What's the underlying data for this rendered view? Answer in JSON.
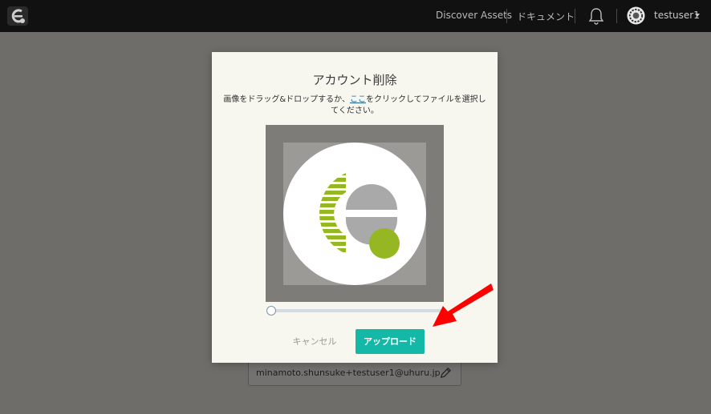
{
  "header": {
    "nav_items": [
      "Discover Assets",
      "ドキュメント"
    ],
    "username": "testuser1",
    "icons": [
      "app-logo-icon",
      "bell-icon",
      "avatar-icon",
      "caret-down-icon"
    ]
  },
  "profile": {
    "email": "minamoto.shunsuke+testuser1@uhuru.jp",
    "edit_icon": "pencil-icon"
  },
  "modal": {
    "title": "アカウント削除",
    "instruction_before_link": "画像をドラッグ&ドロップするか、",
    "instruction_link": "ここ",
    "instruction_after_link": "をクリックしてファイルを選択してください。",
    "zoom_slider_value": 0,
    "cancel_label": "キャンセル",
    "upload_label": "アップロード"
  },
  "colors": {
    "topbar": "#111111",
    "backdrop": "#6e6d69",
    "modal_bg": "#f7f6ef",
    "primary_button": "#13b8a6",
    "logo_green": "#95b722",
    "logo_gray": "#a9a9a9",
    "annotation_arrow": "#ff0000"
  }
}
